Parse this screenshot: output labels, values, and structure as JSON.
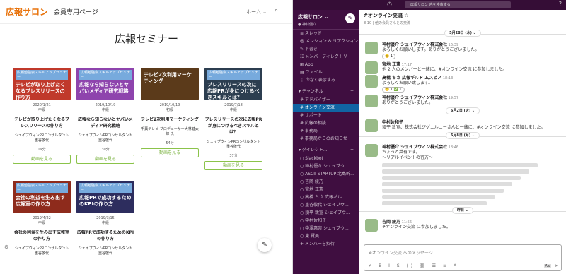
{
  "left": {
    "logo": "広報サロン",
    "subtitle": "会員専用ページ",
    "nav": "ホーム ⌄",
    "page_title": "広報セミナー"
  },
  "cards": [
    {
      "tag": "広報勉強会スキルアップセミナー",
      "thumb_title": "テレビが取り上げたくなるプレスリリースの作り方",
      "date": "2020/1/21",
      "cat": "中級",
      "title": "テレビが取り上げたくなるプレスリリースの作り方",
      "author": "シェイプウィンPRコンサルタント 重谷敬代",
      "count": "19分",
      "btn": "動画を見る",
      "bg": "#c0392b"
    },
    {
      "tag": "広報勉強会スキルアップセミナー",
      "thumb_title": "広報なら知らないとヤバいメディア研究戦略",
      "date": "2019/10/19",
      "cat": "中級",
      "title": "広報なら知らないとヤバいメディア研究戦略",
      "author": "シェイプウィンPRコンサルタント 重谷敬代",
      "count": "30分",
      "btn": "動画を見る",
      "bg": "#8e44ad"
    },
    {
      "tag": "",
      "thumb_title": "テレビ2次利用マーケティング",
      "date": "2019/10/19",
      "cat": "初級",
      "title": "テレビ2次利用マーケティング",
      "author": "千葉テレビ プロデューサー大林健太郎 氏",
      "count": "54分",
      "btn": "動画を見る",
      "bg": "#5b3a1a"
    },
    {
      "tag": "広報勉強会スキルアップセミナー",
      "thumb_title": "プレスリリースの次に広報PRが身につけるべきスキルとは？",
      "date": "2019/7/18",
      "cat": "中級",
      "title": "プレスリリースの次に広報PRが身につけるべきスキルとは？",
      "author": "シェイプウィンPRコンサルタント 重谷敬代",
      "count": "37分",
      "btn": "動画を見る",
      "bg": "#2c3e50"
    },
    {
      "tag": "広報勉強会スキルアップセミナー",
      "thumb_title": "会社の利益を生み出す広報室の作り方",
      "date": "2019/4/22",
      "cat": "中級",
      "title": "会社の利益を生み出す広報室の作り方",
      "author": "シェイプウィンPRコンサルタント 重谷敬代",
      "count": "",
      "btn": "",
      "bg": "#8e2b1c"
    },
    {
      "tag": "広報勉強会スキルアップセミナー",
      "thumb_title": "広報PRで成功するためのKPIの作り方",
      "date": "2019/3/15",
      "cat": "中級",
      "title": "広報PRで成功するためのKPIの作り方",
      "author": "シェイプウィンPRコンサルタント 重谷敬代",
      "count": "",
      "btn": "",
      "bg": "#2d2d5e"
    }
  ],
  "slack": {
    "search": "広報サロン 内を検索する",
    "workspace": "広報サロン ⌄",
    "user": "● 神村優介",
    "nav": [
      "スレッド",
      "メンション & リアクション",
      "下書き",
      "メンバーディレクトリ",
      "App",
      "ファイル",
      "少なく表示する"
    ],
    "channels_header": "チャンネル",
    "channels": [
      "アドバイザー",
      "# オンライン交流",
      "サポート",
      "広報の相談",
      "事務局",
      "事務局からのお知らせ"
    ],
    "dm_header": "ダイレクト...",
    "dms": [
      "Slackbot",
      "神村優介 シェイプウ...",
      "ASCII STARTUP 北島幹...",
      "吉岡 綾乃",
      "宮地 正憲",
      "高橋 ちさ 広報ギル...",
      "重谷敬代 シェイプウ...",
      "須平 致宣 シェイプウ...",
      "中村佐和子",
      "中澤惠崇 シェイプウ...",
      "東 賢美"
    ],
    "add_member": "+ メンバーを招待",
    "channel_name": "#オンライン交流 ☆",
    "channel_desc": "8 10 | 他の会員さんとの交流",
    "messages": [
      {
        "name": "神村優介 シェイプウィン株式会社",
        "ts": "16:39",
        "text": "よろしくお願いします。ありがとうございました。",
        "react": "🙂 1"
      },
      {
        "name": "宮地 正憲",
        "ts": "17:17",
        "text": "他 2 人のメンバーと一緒に、#オンライン交流 に参加しました。",
        "react": ""
      },
      {
        "name": "高橋 ちさ 広報ギルド ムスビノ",
        "ts": "18:13",
        "text": "よろしくお願い致します。",
        "react": "🙂 1  ✅ 1"
      },
      {
        "name": "神村優介 シェイプウィン株式会社",
        "ts": "19:57",
        "text": "ありがとうございました。",
        "react": ""
      }
    ],
    "div1": "5月28日 (木) ⌄",
    "div2": "6月2日 (火) ⌄",
    "msg2": {
      "name": "中村佐和子",
      "ts": "",
      "text": "須平 致宣、株式会社ジゲェルニーさんと一緒に、#オンライン交流 に参加しました。"
    },
    "div3": "6月8日 (月) ⌄",
    "msg3": {
      "name": "神村優介 シェイプウィン株式会社",
      "ts": "18:46",
      "text": "ちょっと共有です。\n〜リアルイベントの行方〜"
    },
    "div4": "昨日 ⌄",
    "msg4": {
      "name": "吉岡 綾乃",
      "ts": "11:56",
      "text": "#オンライン交流 に参加しました。"
    },
    "composer": "#オンライン交流 へのメッセージ"
  }
}
